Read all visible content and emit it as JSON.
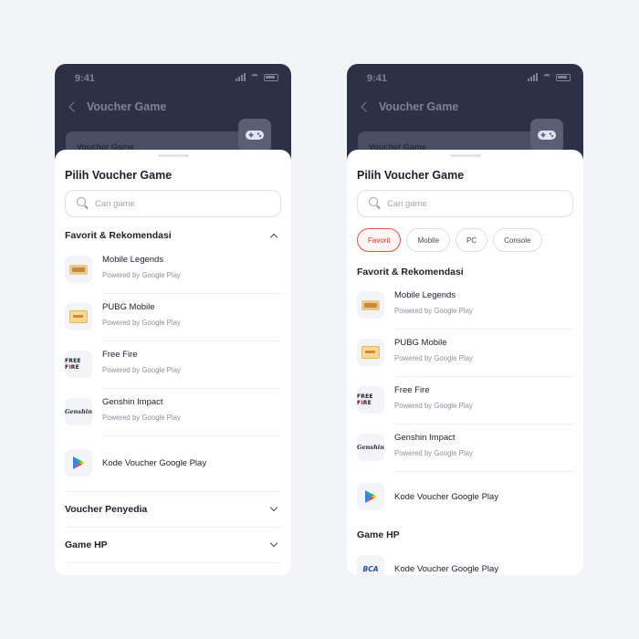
{
  "status": {
    "time": "9:41"
  },
  "header": {
    "title": "Voucher Game",
    "card_label": "Voucher Game"
  },
  "sheet": {
    "title": "Pilih Voucher Game",
    "search_placeholder": "Cari game"
  },
  "filters": [
    {
      "label": "Favorit",
      "active": true
    },
    {
      "label": "Mobile",
      "active": false
    },
    {
      "label": "PC",
      "active": false
    },
    {
      "label": "Console",
      "active": false
    }
  ],
  "sections": {
    "favorit": "Favorit & Rekomendasi",
    "penyedia": "Voucher Penyedia",
    "game_hp": "Game HP"
  },
  "games": [
    {
      "name": "Mobile Legends",
      "sub": "Powered by Google Play",
      "icon": "mobile-legends-logo"
    },
    {
      "name": "PUBG Mobile",
      "sub": "Powered by Google Play",
      "icon": "pubg-logo"
    },
    {
      "name": "Free Fire",
      "sub": "Powered by Google Play",
      "icon": "free-fire-logo"
    },
    {
      "name": "Genshin Impact",
      "sub": "Powered by Google Play",
      "icon": "genshin-logo"
    },
    {
      "name": "Kode Voucher Google Play",
      "icon": "google-play-logo"
    }
  ],
  "game_hp_items": [
    {
      "name": "Kode Voucher Google Play",
      "icon": "bca-logo"
    }
  ],
  "logos": {
    "free_fire": [
      "FREE F",
      "I",
      "RE"
    ],
    "genshin": "Genshin",
    "bca": "BCA"
  }
}
